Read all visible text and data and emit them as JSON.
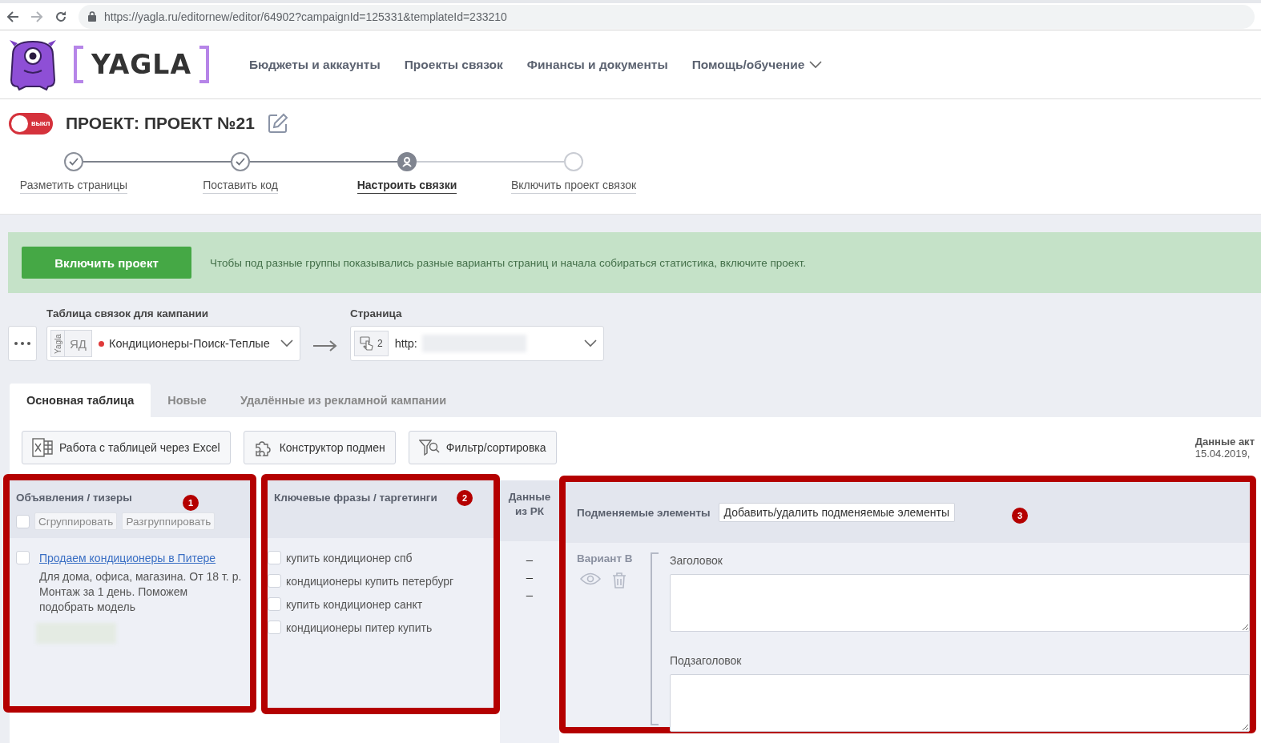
{
  "browser": {
    "url": "https://yagla.ru/editornew/editor/64902?campaignId=125331&templateId=233210"
  },
  "header": {
    "logo": "YAGLA",
    "nav": [
      {
        "label": "Бюджеты и аккаунты",
        "has_menu": false
      },
      {
        "label": "Проекты связок",
        "has_menu": false
      },
      {
        "label": "Финансы и документы",
        "has_menu": false
      },
      {
        "label": "Помощь/обучение",
        "has_menu": true
      }
    ]
  },
  "project": {
    "enabled": false,
    "toggle_label": "выкл",
    "title": "ПРОЕКТ: ПРОЕКТ №21"
  },
  "steps": [
    {
      "label": "Разметить страницы",
      "done": true,
      "current": false
    },
    {
      "label": "Поставить код",
      "done": true,
      "current": false
    },
    {
      "label": "Настроить связки",
      "done": false,
      "current": true
    },
    {
      "label": "Включить проект связок",
      "done": false,
      "current": false
    }
  ],
  "banner": {
    "button": "Включить проект",
    "message": "Чтобы под разные группы показывались разные варианты страниц и начала собираться статистика, включите проект."
  },
  "campaign": {
    "label": "Таблица связок для кампании",
    "badges": [
      "Yagla",
      "ЯД"
    ],
    "color": "#e03a3a",
    "value": "Кондиционеры-Поиск-Теплые"
  },
  "page": {
    "label": "Страница",
    "count": "2",
    "value": "http:"
  },
  "tabs": [
    {
      "label": "Основная таблица",
      "selected": true
    },
    {
      "label": "Новые",
      "selected": false
    },
    {
      "label": "Удалённые из рекламной кампании",
      "selected": false
    }
  ],
  "toolbar": [
    {
      "label": "Работа с таблицей через Excel",
      "kind": "excel"
    },
    {
      "label": "Конструктор подмен",
      "kind": "puzzle"
    },
    {
      "label": "Фильтр/сортировка",
      "kind": "filter"
    }
  ],
  "data_info": {
    "label": "Данные акт",
    "date": "15.04.2019,"
  },
  "ads": {
    "annotation": "1",
    "title": "Объявления / тизеры",
    "select_all_checked": false,
    "buttons": [
      "Сгруппировать",
      "Разгруппировать"
    ],
    "items": [
      {
        "checked": false,
        "title": "Продаем кондиционеры в Питере",
        "text": "Для дома, офиса, магазина. От 18 т. р. Монтаж за 1 день. Поможем подобрать модель"
      }
    ]
  },
  "keywords": {
    "annotation": "2",
    "title": "Ключевые фразы / таргетинги",
    "items": [
      {
        "text": "купить кондиционер спб",
        "checked": false
      },
      {
        "text": "кондиционеры купить петербург",
        "checked": false
      },
      {
        "text": "купить кондиционер санкт",
        "checked": false
      },
      {
        "text": "кондиционеры питер купить",
        "checked": false
      }
    ]
  },
  "campaign_data": {
    "title": "Данные из РК",
    "values": [
      "–",
      "–",
      "–"
    ]
  },
  "substitutions": {
    "annotation": "3",
    "title": "Подменяемые элементы",
    "button": "Добавить/удалить подменяемые элементы",
    "variant": "Вариант В",
    "fields": [
      {
        "label": "Заголовок"
      },
      {
        "label": "Подзаголовок"
      }
    ]
  }
}
